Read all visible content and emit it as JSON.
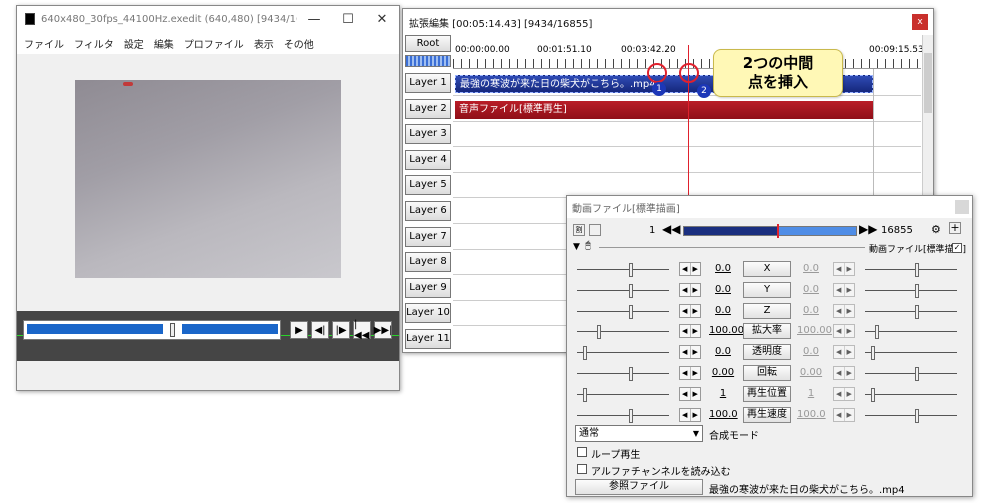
{
  "main_window": {
    "title": "640x480_30fps_44100Hz.exedit (640,480)  [9434/16855] ...",
    "controls": {
      "minimize": "—",
      "maximize": "☐",
      "close": "✕"
    },
    "menu": [
      "ファイル",
      "フィルタ",
      "設定",
      "編集",
      "プロファイル",
      "表示",
      "その他"
    ],
    "playback_buttons": [
      "▶",
      "◀|",
      "|▶",
      "|◀◀",
      "▶▶|"
    ]
  },
  "timeline_window": {
    "title": "拡張編集 [00:05:14.43] [9434/16855]",
    "close_label": "x",
    "root_label": "Root",
    "timecodes": [
      "00:00:00.00",
      "00:01:51.10",
      "00:03:42.20",
      "00:09:15.53"
    ],
    "layers": [
      "Layer 1",
      "Layer 2",
      "Layer 3",
      "Layer 4",
      "Layer 5",
      "Layer 6",
      "Layer 7",
      "Layer 8",
      "Layer 9",
      "Layer 10",
      "Layer 11"
    ],
    "clips": [
      {
        "label": "最強の寒波が来た日の柴犬がこちら。.mp4",
        "color": "#1a2f8f"
      },
      {
        "label": "音声ファイル[標準再生]",
        "color": "#a0141d"
      }
    ],
    "markers": [
      "1",
      "2"
    ],
    "callout": [
      "2つの中間",
      "点を挿入"
    ]
  },
  "properties_window": {
    "title": "動画ファイル[標準描画]",
    "frame_start": "1",
    "frame_end": "16855",
    "sub_label": "動画ファイル[標準描画]",
    "params": [
      {
        "label": "X",
        "left": "0.0",
        "right": "0.0"
      },
      {
        "label": "Y",
        "left": "0.0",
        "right": "0.0"
      },
      {
        "label": "Z",
        "left": "0.0",
        "right": "0.0"
      },
      {
        "label": "拡大率",
        "left": "100.00",
        "right": "100.00"
      },
      {
        "label": "透明度",
        "left": "0.0",
        "right": "0.0"
      },
      {
        "label": "回転",
        "left": "0.00",
        "right": "0.00"
      },
      {
        "label": "再生位置",
        "left": "1",
        "right": "1"
      },
      {
        "label": "再生速度",
        "left": "100.0",
        "right": "100.0"
      }
    ],
    "blend_mode_value": "通常",
    "blend_mode_label": "合成モード",
    "loop_label": "ループ再生",
    "alpha_label": "アルファチャンネルを読み込む",
    "ref_button": "参照ファイル",
    "filename": "最強の寒波が来た日の柴犬がこちら。.mp4"
  },
  "colors": {
    "playhead": "#e0212d",
    "video_clip": "#1a2f8f",
    "audio_clip": "#a0141d",
    "callout_bg": "#fff8b6",
    "marker_dot": "#1c37b8"
  }
}
